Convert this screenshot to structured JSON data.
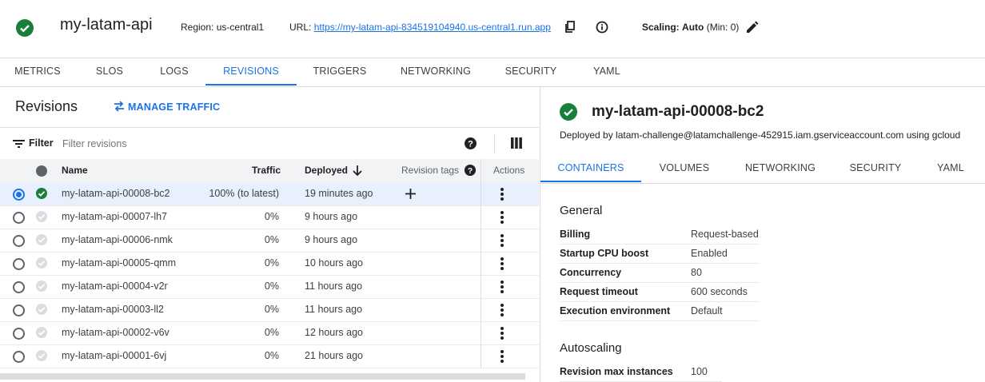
{
  "service": {
    "name": "my-latam-api",
    "region_label": "Region:",
    "region": "us-central1",
    "url_label": "URL:",
    "url": "https://my-latam-api-834519104940.us-central1.run.app",
    "scaling_label": "Scaling:",
    "scaling_value": "Auto",
    "scaling_min": "(Min: 0)"
  },
  "tabs": [
    "METRICS",
    "SLOS",
    "LOGS",
    "REVISIONS",
    "TRIGGERS",
    "NETWORKING",
    "SECURITY",
    "YAML"
  ],
  "active_tab": "REVISIONS",
  "revisions_panel": {
    "title": "Revisions",
    "manage_traffic": "MANAGE TRAFFIC",
    "filter_label": "Filter",
    "filter_placeholder": "Filter revisions",
    "columns": {
      "name": "Name",
      "traffic": "Traffic",
      "deployed": "Deployed",
      "tags": "Revision tags",
      "actions": "Actions"
    },
    "rows": [
      {
        "name": "my-latam-api-00008-bc2",
        "traffic": "100% (to latest)",
        "deployed": "19 minutes ago"
      },
      {
        "name": "my-latam-api-00007-lh7",
        "traffic": "0%",
        "deployed": "9 hours ago"
      },
      {
        "name": "my-latam-api-00006-nmk",
        "traffic": "0%",
        "deployed": "9 hours ago"
      },
      {
        "name": "my-latam-api-00005-qmm",
        "traffic": "0%",
        "deployed": "10 hours ago"
      },
      {
        "name": "my-latam-api-00004-v2r",
        "traffic": "0%",
        "deployed": "11 hours ago"
      },
      {
        "name": "my-latam-api-00003-ll2",
        "traffic": "0%",
        "deployed": "11 hours ago"
      },
      {
        "name": "my-latam-api-00002-v6v",
        "traffic": "0%",
        "deployed": "12 hours ago"
      },
      {
        "name": "my-latam-api-00001-6vj",
        "traffic": "0%",
        "deployed": "21 hours ago"
      }
    ]
  },
  "detail": {
    "title": "my-latam-api-00008-bc2",
    "deployed_by": "Deployed by latam-challenge@latamchallenge-452915.iam.gserviceaccount.com using gcloud",
    "tabs": [
      "CONTAINERS",
      "VOLUMES",
      "NETWORKING",
      "SECURITY",
      "YAML"
    ],
    "active_tab": "CONTAINERS",
    "general_title": "General",
    "general": [
      {
        "key": "Billing",
        "value": "Request-based"
      },
      {
        "key": "Startup CPU boost",
        "value": "Enabled"
      },
      {
        "key": "Concurrency",
        "value": "80"
      },
      {
        "key": "Request timeout",
        "value": "600 seconds"
      },
      {
        "key": "Execution environment",
        "value": "Default"
      }
    ],
    "autoscaling_title": "Autoscaling",
    "autoscaling": [
      {
        "key": "Revision max instances",
        "value": "100"
      }
    ]
  },
  "colors": {
    "accent": "#1a73e8",
    "success": "#188038",
    "inactive": "#dadce0"
  }
}
